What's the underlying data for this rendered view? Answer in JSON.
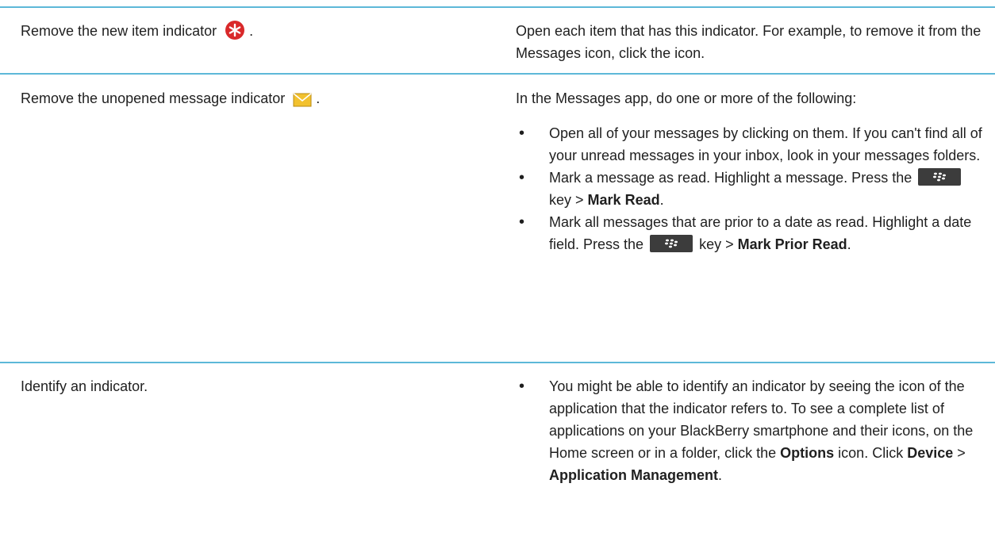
{
  "rows": [
    {
      "action_before": "Remove the new item indicator",
      "action_after": ".",
      "icon": "new-item-star-icon",
      "solution": "Open each item that has this indicator. For example, to remove it from the Messages icon, click the icon."
    },
    {
      "action_before": "Remove the unopened message indicator",
      "action_after": ".",
      "icon": "envelope-icon",
      "intro": "In the Messages app, do one or more of the following:",
      "bullets": {
        "b1": "Open all of your messages by clicking on them. If you can't find all of your unread messages in your inbox, look in your messages folders.",
        "b2_before": "Mark a message as read. Highlight a message. Press the",
        "b2_after": "key >",
        "b2_bold": "Mark Read",
        "b2_end": ".",
        "b3_before": "Mark all messages that are prior to a date as read. Highlight a date field. Press the",
        "b3_after": "key >",
        "b3_bold": "Mark Prior Read",
        "b3_end": "."
      }
    },
    {
      "action": "Identify an indicator.",
      "b_text1": "You might be able to identify an indicator by seeing the icon of the application that the indicator refers to. To see a complete list of applications on your BlackBerry smartphone and their icons, on the Home screen or in a folder, click the",
      "b_bold1": "Options",
      "b_text2": "icon. Click",
      "b_bold2": "Device",
      "b_text3": ">",
      "b_bold3": "Application Management",
      "b_end": "."
    }
  ],
  "colors": {
    "divider": "#5db8d8",
    "star": "#d9292a",
    "envelope": "#f2c12e",
    "key": "#3c3c3c"
  }
}
